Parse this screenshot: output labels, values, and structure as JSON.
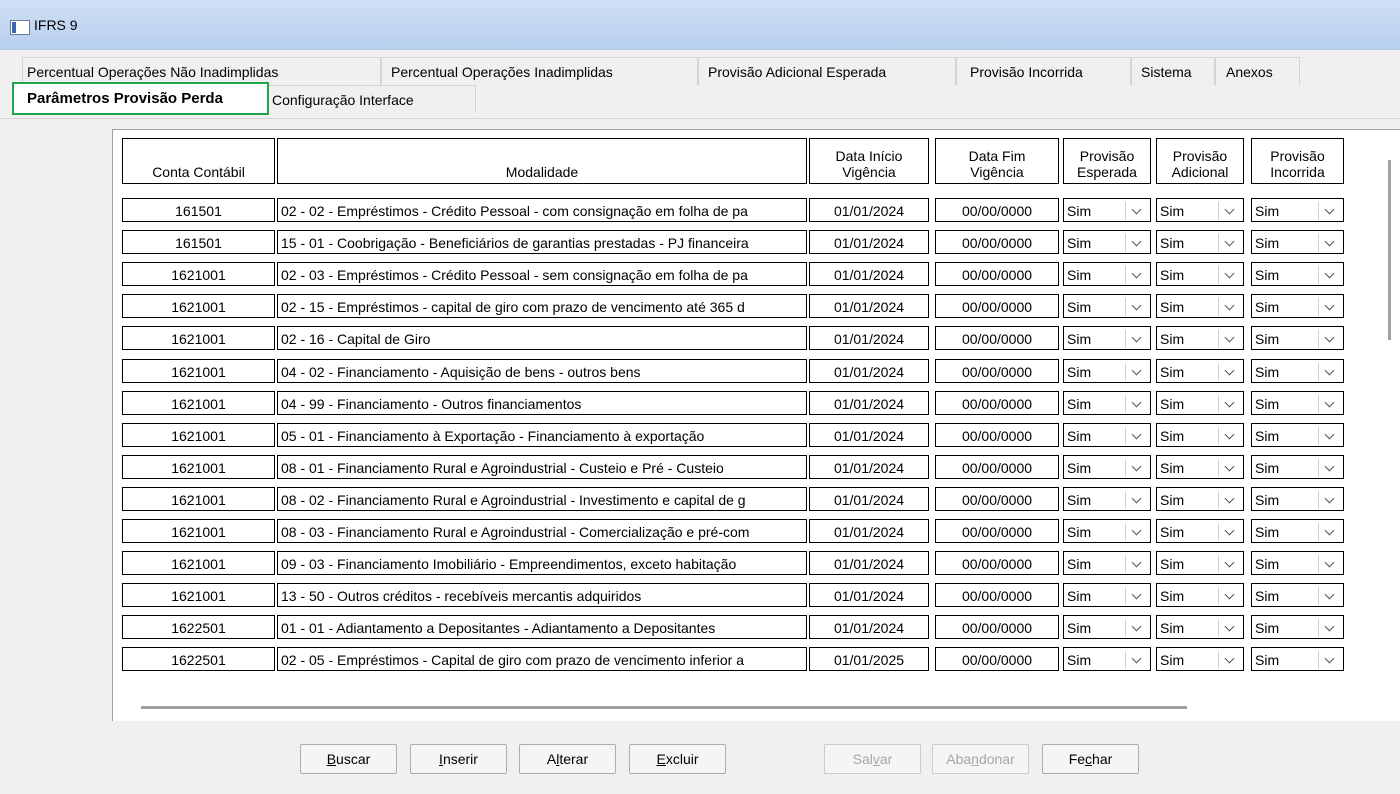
{
  "window": {
    "title": "IFRS 9"
  },
  "tabs_row1": [
    "Percentual Operações Não Inadimplidas",
    "Percentual Operações Inadimplidas",
    "Provisão Adicional Esperada",
    "Provisão Incorrida",
    "Sistema",
    "Anexos"
  ],
  "tabs_row2": [
    "Parâmetros Provisão Perda",
    "Configuração Interface"
  ],
  "grid": {
    "headers": [
      "Conta Contábil",
      "Modalidade",
      "Data Início\nVigência",
      "Data Fim\nVigência",
      "Provisão\nEsperada",
      "Provisão\nAdicional",
      "Provisão\nIncorrida"
    ],
    "rows": [
      {
        "conta": "161501",
        "modalidade": "02 - 02 - Empréstimos - Crédito Pessoal - com consignação em folha de pa",
        "inicio": "01/01/2024",
        "fim": "00/00/0000",
        "esperada": "Sim",
        "adicional": "Sim",
        "incorrida": "Sim"
      },
      {
        "conta": "161501",
        "modalidade": "15 - 01 - Coobrigação - Beneficiários de garantias prestadas - PJ financeira",
        "inicio": "01/01/2024",
        "fim": "00/00/0000",
        "esperada": "Sim",
        "adicional": "Sim",
        "incorrida": "Sim"
      },
      {
        "conta": "1621001",
        "modalidade": "02 - 03 - Empréstimos - Crédito Pessoal - sem consignação em folha de pa",
        "inicio": "01/01/2024",
        "fim": "00/00/0000",
        "esperada": "Sim",
        "adicional": "Sim",
        "incorrida": "Sim"
      },
      {
        "conta": "1621001",
        "modalidade": "02 - 15 - Empréstimos - capital de giro com prazo de vencimento até 365 d",
        "inicio": "01/01/2024",
        "fim": "00/00/0000",
        "esperada": "Sim",
        "adicional": "Sim",
        "incorrida": "Sim"
      },
      {
        "conta": "1621001",
        "modalidade": "02 - 16 - Capital de Giro",
        "inicio": "01/01/2024",
        "fim": "00/00/0000",
        "esperada": "Sim",
        "adicional": "Sim",
        "incorrida": "Sim"
      },
      {
        "conta": "1621001",
        "modalidade": "04 - 02 - Financiamento - Aquisição de bens - outros bens",
        "inicio": "01/01/2024",
        "fim": "00/00/0000",
        "esperada": "Sim",
        "adicional": "Sim",
        "incorrida": "Sim"
      },
      {
        "conta": "1621001",
        "modalidade": "04 - 99 - Financiamento - Outros financiamentos",
        "inicio": "01/01/2024",
        "fim": "00/00/0000",
        "esperada": "Sim",
        "adicional": "Sim",
        "incorrida": "Sim"
      },
      {
        "conta": "1621001",
        "modalidade": "05 - 01 - Financiamento à Exportação - Financiamento à exportação",
        "inicio": "01/01/2024",
        "fim": "00/00/0000",
        "esperada": "Sim",
        "adicional": "Sim",
        "incorrida": "Sim"
      },
      {
        "conta": "1621001",
        "modalidade": "08 - 01 - Financiamento Rural e Agroindustrial - Custeio e Pré - Custeio",
        "inicio": "01/01/2024",
        "fim": "00/00/0000",
        "esperada": "Sim",
        "adicional": "Sim",
        "incorrida": "Sim"
      },
      {
        "conta": "1621001",
        "modalidade": "08 - 02 - Financiamento Rural e Agroindustrial - Investimento e capital de g",
        "inicio": "01/01/2024",
        "fim": "00/00/0000",
        "esperada": "Sim",
        "adicional": "Sim",
        "incorrida": "Sim"
      },
      {
        "conta": "1621001",
        "modalidade": "08 - 03 - Financiamento Rural e Agroindustrial - Comercialização e pré-com",
        "inicio": "01/01/2024",
        "fim": "00/00/0000",
        "esperada": "Sim",
        "adicional": "Sim",
        "incorrida": "Sim"
      },
      {
        "conta": "1621001",
        "modalidade": "09 - 03 - Financiamento Imobiliário - Empreendimentos, exceto habitação",
        "inicio": "01/01/2024",
        "fim": "00/00/0000",
        "esperada": "Sim",
        "adicional": "Sim",
        "incorrida": "Sim"
      },
      {
        "conta": "1621001",
        "modalidade": "13 - 50 - Outros créditos - recebíveis mercantis adquiridos",
        "inicio": "01/01/2024",
        "fim": "00/00/0000",
        "esperada": "Sim",
        "adicional": "Sim",
        "incorrida": "Sim"
      },
      {
        "conta": "1622501",
        "modalidade": "01 - 01 - Adiantamento a Depositantes - Adiantamento a Depositantes",
        "inicio": "01/01/2024",
        "fim": "00/00/0000",
        "esperada": "Sim",
        "adicional": "Sim",
        "incorrida": "Sim"
      },
      {
        "conta": "1622501",
        "modalidade": "02 - 05 - Empréstimos - Capital de giro com prazo de vencimento inferior a",
        "inicio": "01/01/2025",
        "fim": "00/00/0000",
        "esperada": "Sim",
        "adicional": "Sim",
        "incorrida": "Sim"
      }
    ]
  },
  "buttons": [
    {
      "label": "Buscar",
      "enabled": true
    },
    {
      "label": "Inserir",
      "enabled": true
    },
    {
      "label": "Alterar",
      "enabled": true
    },
    {
      "label": "Excluir",
      "enabled": true
    },
    {
      "label": "Salvar",
      "enabled": false
    },
    {
      "label": "Abandonar",
      "enabled": false
    },
    {
      "label": "Fechar",
      "enabled": true
    }
  ],
  "colors": {
    "active_tab_border": "#1fa84a",
    "title_bar": "#b7cfee"
  }
}
